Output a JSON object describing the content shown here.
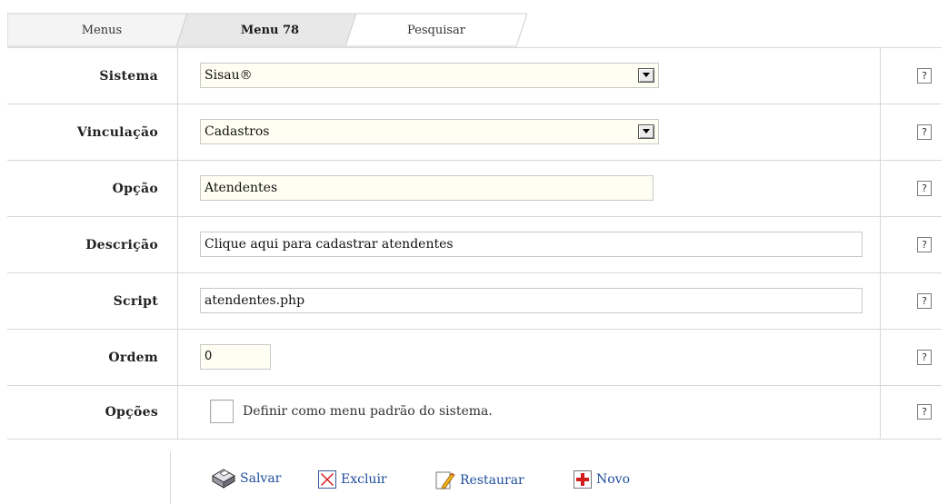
{
  "tabs": [
    {
      "label": "Menus"
    },
    {
      "label": "Menu 78",
      "active": true
    },
    {
      "label": "Pesquisar"
    }
  ],
  "form": {
    "sistema": {
      "label": "Sistema",
      "value": "Sisau®"
    },
    "vinculacao": {
      "label": "Vinculação",
      "value": "Cadastros"
    },
    "opcao": {
      "label": "Opção",
      "value": "Atendentes"
    },
    "descricao": {
      "label": "Descrição",
      "value": "Clique aqui para cadastrar atendentes"
    },
    "script": {
      "label": "Script",
      "value": "atendentes.php"
    },
    "ordem": {
      "label": "Ordem",
      "value": "0"
    },
    "opcoes": {
      "label": "Opções",
      "checkbox_label": "Definir como menu padrão do sistema.",
      "checked": false
    }
  },
  "help_label": "?",
  "actions": {
    "salvar": {
      "label": "Salvar",
      "icon": "diskette-icon"
    },
    "excluir": {
      "label": "Excluir",
      "icon": "red-x-icon"
    },
    "restaurar": {
      "label": "Restaurar",
      "icon": "pencil-icon"
    },
    "novo": {
      "label": "Novo",
      "icon": "red-plus-icon"
    }
  },
  "colors": {
    "link": "#1f4e9c",
    "input_bg": "#fffef2",
    "active_tab_bg": "#e8e8e8",
    "border": "#d8d8d8"
  }
}
